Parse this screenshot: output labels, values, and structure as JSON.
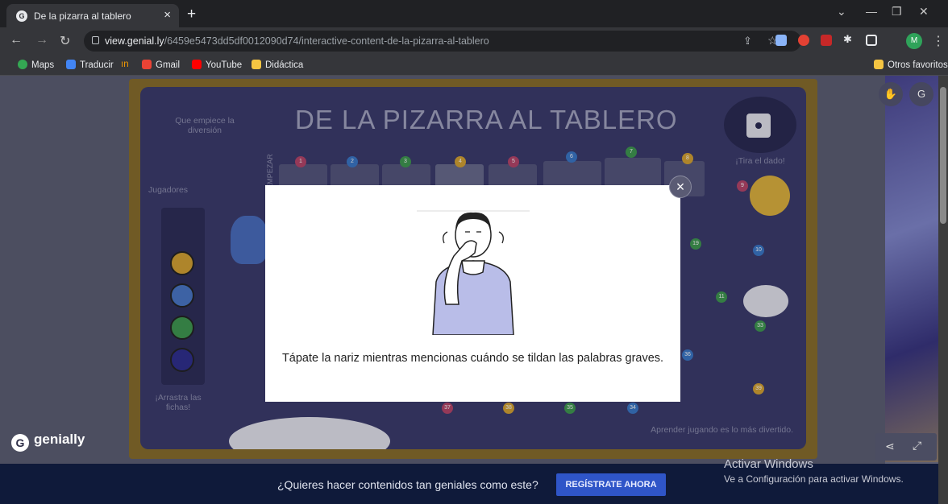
{
  "browser": {
    "tab_title": "De la pizarra al tablero",
    "tab_favicon": "G",
    "url_host": "view.genial.ly",
    "url_path": "/6459e5473dd5df0012090d74/interactive-content-de-la-pizarra-al-tablero",
    "profile_initial": "M",
    "bookmarks": [
      "Maps",
      "Traducir",
      "Gmail",
      "YouTube",
      "Didáctica"
    ],
    "other_bookmarks": "Otros favoritos"
  },
  "board": {
    "title": "DE LA PIZARRA AL TABLERO",
    "top_left_note": "Que empiece la diversión",
    "dice_label": "¡Tira el dado!",
    "players_label": "Jugadores",
    "drag_hint": "¡Arrastra las fichas!",
    "start_label": "EMPEZAR",
    "footer_note": "Aprender jugando es lo más divertido.",
    "cells": [
      "1",
      "2",
      "3",
      "4",
      "5",
      "6",
      "7",
      "8",
      "9",
      "10",
      "11",
      "19",
      "33",
      "34",
      "35",
      "36",
      "37",
      "38",
      "39"
    ]
  },
  "modal": {
    "text": "Tápate la nariz mientras mencionas cuándo se tildan las palabras graves."
  },
  "brand": {
    "name": "genially",
    "logo": "G"
  },
  "cta": {
    "text": "¿Quieres hacer contenidos tan geniales como este?",
    "button": "REGÍSTRATE AHORA"
  },
  "windows": {
    "title": "Activar Windows",
    "subtitle": "Ve a Configuración para activar Windows."
  },
  "colors": {
    "accent": "#2f55c8",
    "board_bg": "#3b3b6c"
  }
}
